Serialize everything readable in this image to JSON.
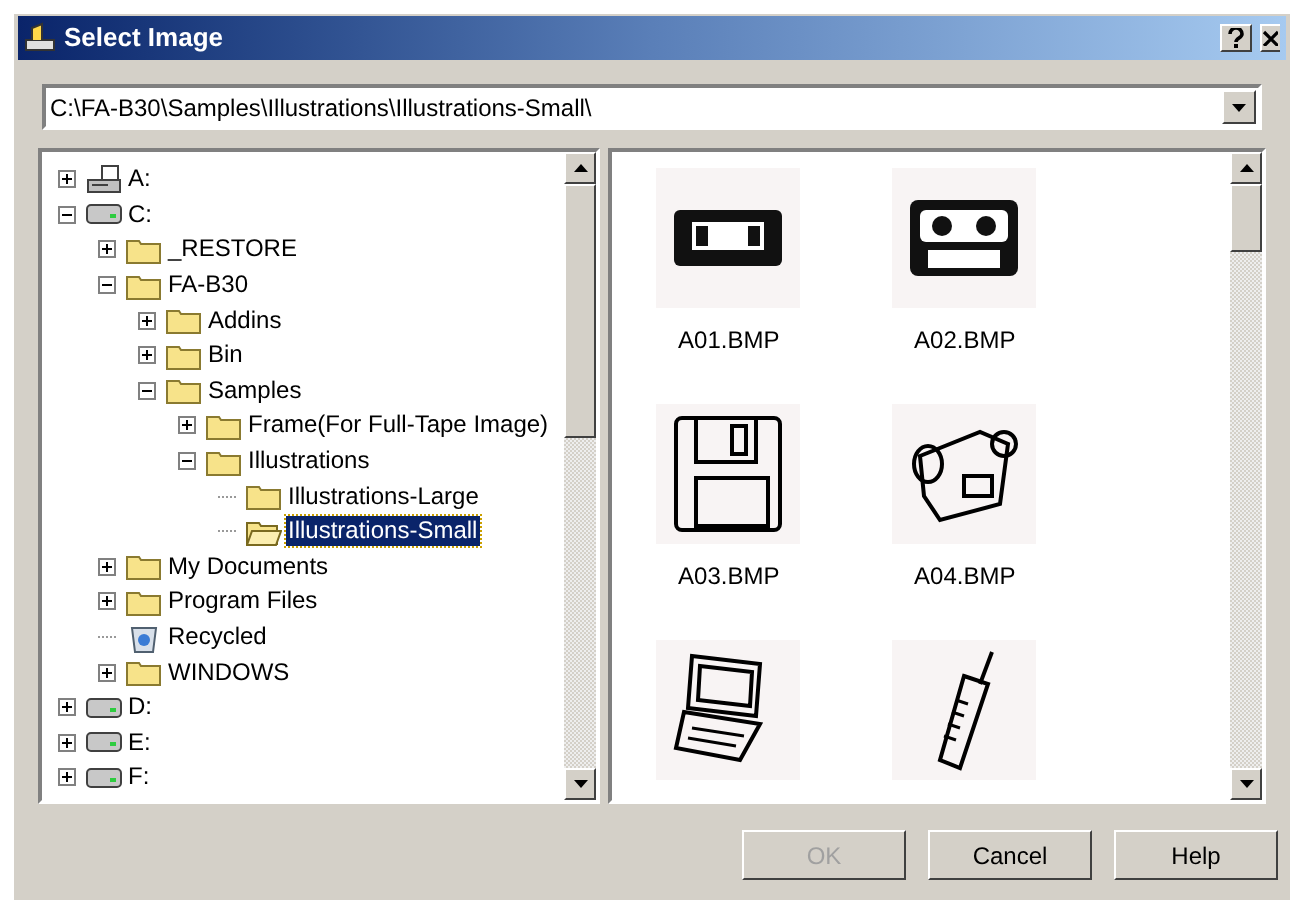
{
  "window": {
    "title": "Select Image"
  },
  "path": {
    "value": "C:\\FA-B30\\Samples\\Illustrations\\Illustrations-Small\\"
  },
  "tree": [
    {
      "label": "A:",
      "kind": "floppy",
      "expanded": false,
      "selected": false
    },
    {
      "label": "C:",
      "kind": "drive",
      "expanded": true,
      "selected": false,
      "children": [
        {
          "label": "_RESTORE",
          "kind": "folder",
          "expanded": false,
          "selected": false
        },
        {
          "label": "FA-B30",
          "kind": "folder",
          "expanded": true,
          "selected": false,
          "children": [
            {
              "label": "Addins",
              "kind": "folder",
              "expanded": false,
              "selected": false
            },
            {
              "label": "Bin",
              "kind": "folder",
              "expanded": false,
              "selected": false
            },
            {
              "label": "Samples",
              "kind": "folder",
              "expanded": true,
              "selected": false,
              "children": [
                {
                  "label": "Frame(For Full-Tape Image)",
                  "kind": "folder",
                  "expanded": false,
                  "selected": false
                },
                {
                  "label": "Illustrations",
                  "kind": "folder",
                  "expanded": true,
                  "selected": false,
                  "children": [
                    {
                      "label": "Illustrations-Large",
                      "kind": "folder",
                      "selected": false
                    },
                    {
                      "label": "Illustrations-Small",
                      "kind": "folder",
                      "selected": true
                    }
                  ]
                }
              ]
            }
          ]
        },
        {
          "label": "My Documents",
          "kind": "folder",
          "expanded": false,
          "selected": false
        },
        {
          "label": "Program Files",
          "kind": "folder",
          "expanded": false,
          "selected": false
        },
        {
          "label": "Recycled",
          "kind": "recycle",
          "selected": false
        },
        {
          "label": "WINDOWS",
          "kind": "folder",
          "expanded": false,
          "selected": false
        }
      ]
    },
    {
      "label": "D:",
      "kind": "drive",
      "expanded": false,
      "selected": false
    },
    {
      "label": "E:",
      "kind": "drive",
      "expanded": false,
      "selected": false
    },
    {
      "label": "F:",
      "kind": "drive",
      "expanded": false,
      "selected": false
    }
  ],
  "thumbnails": [
    {
      "label": "A01.BMP",
      "kind": "vhs"
    },
    {
      "label": "A02.BMP",
      "kind": "cassette"
    },
    {
      "label": "A03.BMP",
      "kind": "floppy"
    },
    {
      "label": "A04.BMP",
      "kind": "camcorder"
    },
    {
      "kind": "laptop"
    },
    {
      "kind": "phone"
    }
  ],
  "buttons": [
    {
      "label": "OK",
      "disabled": true
    },
    {
      "label": "Cancel",
      "disabled": false
    },
    {
      "label": "Help",
      "disabled": false
    }
  ]
}
